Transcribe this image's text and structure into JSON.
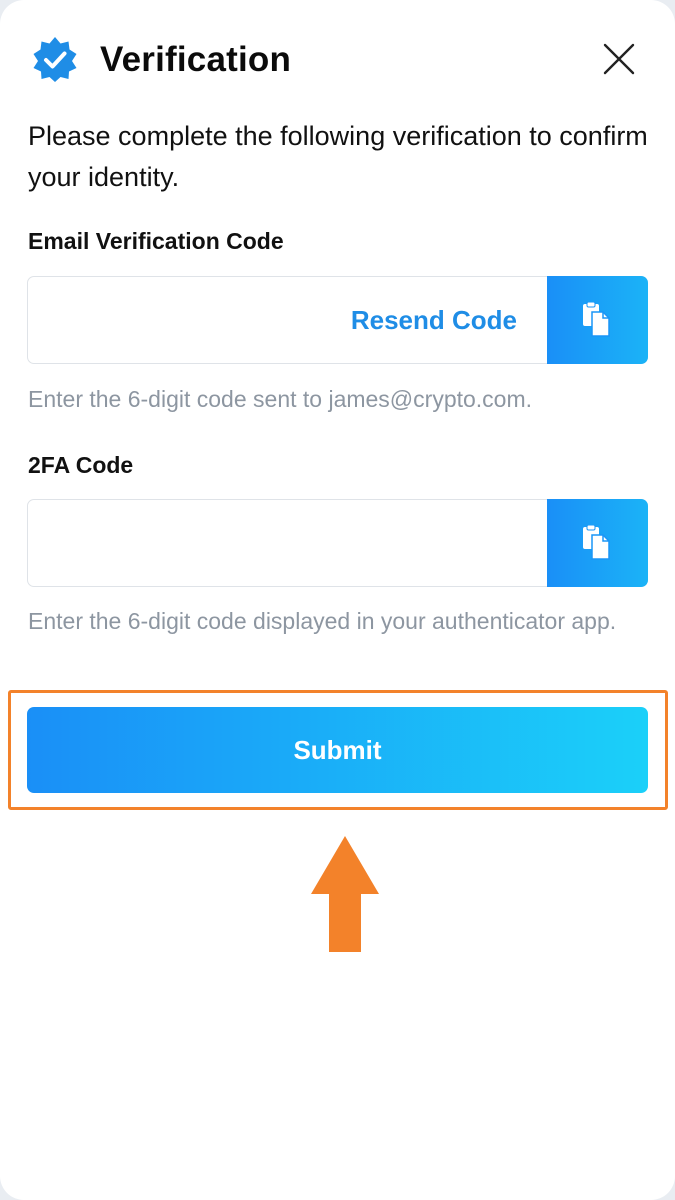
{
  "header": {
    "title": "Verification",
    "badge_icon": "verified-check-badge",
    "close_icon": "close-x"
  },
  "intro": "Please complete the following verification to confirm your identity.",
  "email_section": {
    "label": "Email Verification Code",
    "value": "",
    "resend_label": "Resend Code",
    "paste_icon": "paste-clipboard",
    "hint": "Enter the 6-digit code sent to james@crypto.com."
  },
  "twofa_section": {
    "label": "2FA Code",
    "value": "",
    "paste_icon": "paste-clipboard",
    "hint": "Enter the 6-digit code displayed in your authenticator app."
  },
  "submit_label": "Submit",
  "colors": {
    "accent": "#1F8DE6",
    "gradient_start": "#1A8FF7",
    "gradient_end": "#1BD0F9",
    "highlight": "#F3822A",
    "hint_text": "#8D96A1"
  }
}
